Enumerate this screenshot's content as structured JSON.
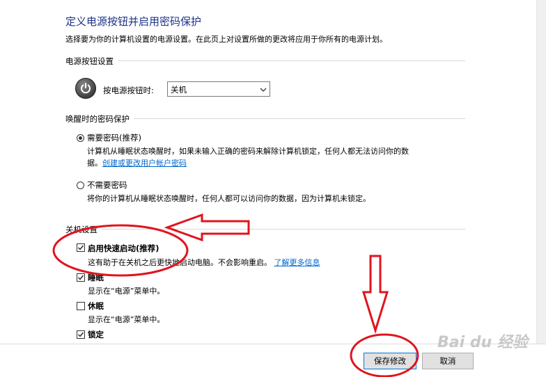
{
  "page": {
    "title": "定义电源按钮并启用密码保护",
    "subtitle": "选择要为你的计算机设置的电源设置。在此页上对设置所做的更改将应用于你所有的电源计划。"
  },
  "power_button_section": {
    "heading": "电源按钮设置",
    "label": "按电源按钮时:",
    "selected": "关机"
  },
  "wake_password_section": {
    "heading": "唤醒时的密码保护",
    "options": [
      {
        "label": "需要密码(推荐)",
        "selected": true,
        "desc_line1": "计算机从睡眠状态唤醒时，如果未输入正确的密码来解除计算机锁定，任何人都无法访问你的数",
        "desc_line2": "据。",
        "link": "创建或更改用户帐户密码"
      },
      {
        "label": "不需要密码",
        "selected": false,
        "desc_line1": "将你的计算机从睡眠状态唤醒时，任何人都可以访问你的数据，因为计算机未锁定。"
      }
    ]
  },
  "shutdown_section": {
    "heading": "关机设置",
    "items": [
      {
        "label": "启用快速启动(推荐)",
        "checked": true,
        "desc": "这有助于在关机之后更快地启动电脑。不会影响重启。",
        "link": "了解更多信息"
      },
      {
        "label": "睡眠",
        "checked": true,
        "desc": "显示在“电源”菜单中。"
      },
      {
        "label": "休眠",
        "checked": false,
        "desc": "显示在“电源”菜单中。"
      },
      {
        "label": "锁定",
        "checked": true
      }
    ]
  },
  "footer": {
    "save_label": "保存修改",
    "cancel_label": "取消"
  },
  "watermark": {
    "text": "Bai du 经验"
  },
  "colors": {
    "title": "#1e3287",
    "link": "#0066cc",
    "annotation": "#e0141e",
    "primary_border": "#0078d7"
  }
}
